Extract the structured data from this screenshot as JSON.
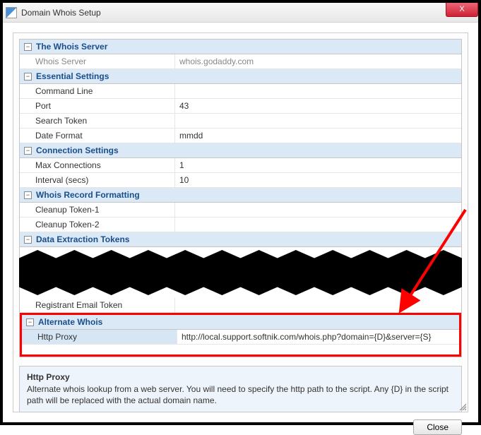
{
  "window": {
    "title": "Domain Whois Setup",
    "close_x": "X"
  },
  "sections": {
    "whois_server": {
      "title": "The Whois Server",
      "rows": {
        "server_label": "Whois Server",
        "server_value": "whois.godaddy.com"
      }
    },
    "essential": {
      "title": "Essential Settings",
      "rows": {
        "command_line": "Command Line",
        "command_line_value": "",
        "port": "Port",
        "port_value": "43",
        "search_token": "Search Token",
        "search_token_value": "",
        "date_format": "Date Format",
        "date_format_value": "mmdd"
      }
    },
    "connection": {
      "title": "Connection Settings",
      "rows": {
        "max_conn": "Max Connections",
        "max_conn_value": "1",
        "interval": "Interval (secs)",
        "interval_value": "10"
      }
    },
    "formatting": {
      "title": "Whois Record Formatting",
      "rows": {
        "cleanup1": "Cleanup Token-1",
        "cleanup1_value": "",
        "cleanup2": "Cleanup Token-2",
        "cleanup2_value": ""
      }
    },
    "extraction": {
      "title": "Data Extraction Tokens",
      "rows": {
        "registrant_email": "Registrant Email Token",
        "registrant_email_value": ""
      }
    },
    "alternate": {
      "title": "Alternate Whois",
      "rows": {
        "http_proxy": "Http Proxy",
        "http_proxy_value": "http://local.support.softnik.com/whois.php?domain={D}&server={S}"
      }
    }
  },
  "description": {
    "title": "Http Proxy",
    "text": "Alternate whois lookup from a web server. You will need to specify the http path to the script. Any {D} in the script path will be replaced with the actual domain name."
  },
  "footer": {
    "close_label": "Close"
  },
  "annotation": {
    "highlight_color": "#ff0000",
    "arrow_color": "#ff0000"
  }
}
